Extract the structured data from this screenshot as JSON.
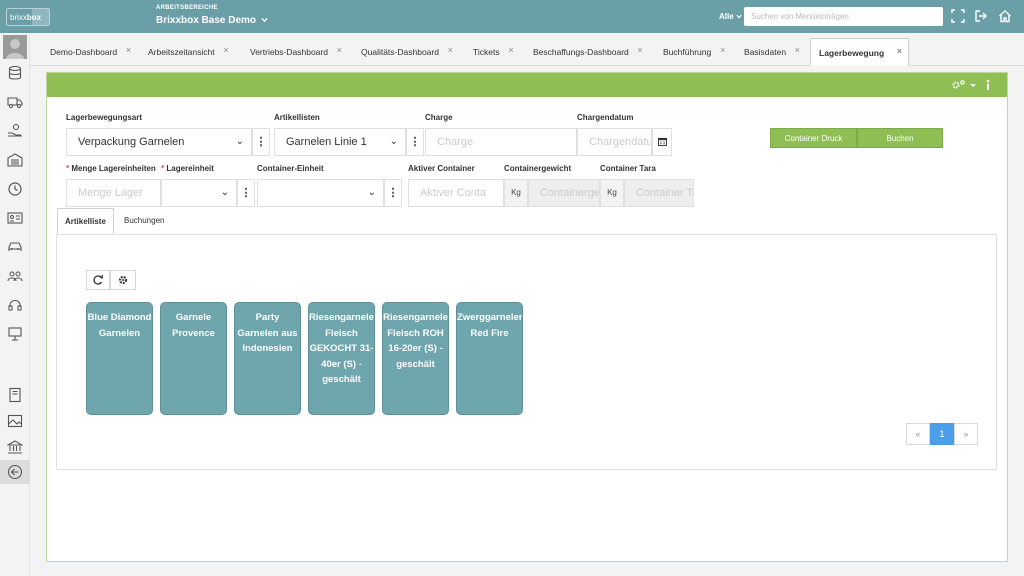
{
  "topbar": {
    "logo": "brixxbox",
    "area_label": "ARBEITSBEREICHE",
    "area_name": "Brixxbox Base Demo",
    "filter_label": "Alle",
    "search_placeholder": "Suchen von Menüeinträgen"
  },
  "tabs": [
    {
      "label": "Demo-Dashboard"
    },
    {
      "label": "Arbeitszeitansicht"
    },
    {
      "label": "Vertriebs-Dashboard"
    },
    {
      "label": "Qualitäts-Dashboard"
    },
    {
      "label": "Tickets"
    },
    {
      "label": "Beschaffungs-Dashboard"
    },
    {
      "label": "Buchführung"
    },
    {
      "label": "Basisdaten"
    },
    {
      "label": "Lagerbewegung"
    }
  ],
  "tab_close": "×",
  "form": {
    "lagerbewegungsart": {
      "label": "Lagerbewegungsart",
      "value": "Verpackung Garnelen"
    },
    "artikellisten": {
      "label": "Artikellisten",
      "value": "Garnelen Linie 1"
    },
    "charge": {
      "label": "Charge",
      "placeholder": "Charge"
    },
    "chargendatum": {
      "label": "Chargendatum",
      "placeholder": "Chargendatum"
    },
    "menge": {
      "label": "Menge Lagereinheiten",
      "placeholder": "Menge Lager",
      "required_mark": "*"
    },
    "lagereinheit": {
      "label": "Lagereinheit",
      "required_mark": "*"
    },
    "container_einheit": {
      "label": "Container-Einheit"
    },
    "aktiver_container": {
      "label": "Aktiver Container",
      "placeholder": "Aktiver Conta"
    },
    "containergewicht": {
      "label": "Containergewicht",
      "unit": "Kg",
      "placeholder": "Containergewicht"
    },
    "container_tara": {
      "label": "Container Tara",
      "unit": "Kg",
      "placeholder": "Container Tara"
    },
    "container_druck_button": "Container Druck",
    "buchen_button": "Buchen"
  },
  "subtabs": [
    {
      "label": "Artikelliste"
    },
    {
      "label": "Buchungen"
    }
  ],
  "tiles": [
    {
      "label": "Blue Diamond Garnelen"
    },
    {
      "label": "Garnele Provence"
    },
    {
      "label": "Party Garnelen aus Indonesien"
    },
    {
      "label": "Riesengarnelen Fleisch GEKOCHT 31-40er (S) - geschält"
    },
    {
      "label": "Riesengarnelen Fleisch ROH 16-20er (S) - geschält"
    },
    {
      "label": "Zwerggarnelen Red Fire"
    }
  ],
  "pagination": {
    "prev": "«",
    "current": "1",
    "next": "»"
  },
  "colors": {
    "topbar": "#6a9fa8",
    "panel_header": "#8fbf54",
    "tile": "#6fa6ae",
    "pager_active": "#4c9ee8"
  },
  "icons": {
    "top": [
      "expand-icon",
      "logout-icon",
      "home-icon"
    ],
    "panel": [
      "settings-icon",
      "info-icon"
    ],
    "sidebar": [
      "database-icon",
      "truck-icon",
      "hand-coin-icon",
      "warehouse-icon",
      "clock-icon",
      "id-card-icon",
      "car-icon",
      "users-icon",
      "headset-icon",
      "presentation-icon",
      "book-icon",
      "image-icon",
      "bank-icon",
      "back-icon"
    ]
  }
}
